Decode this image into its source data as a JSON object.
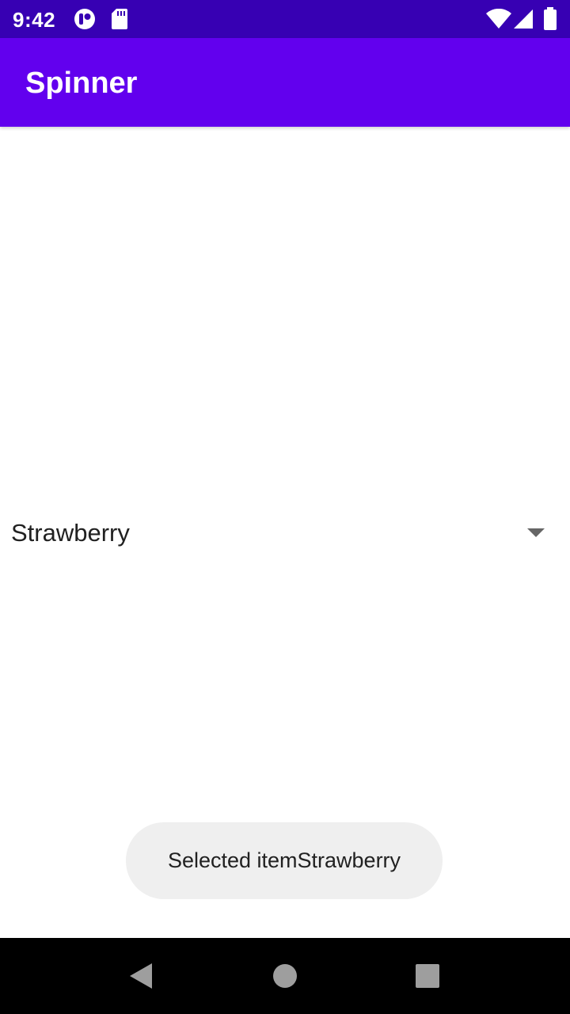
{
  "status_bar": {
    "time": "9:42",
    "icons": [
      "notification-app-icon",
      "sd-card-icon",
      "wifi-icon",
      "cellular-signal-icon",
      "battery-icon"
    ]
  },
  "app_bar": {
    "title": "Spinner",
    "color": "#6200ee",
    "status_color": "#3700b3"
  },
  "spinner": {
    "selected_value": "Strawberry",
    "icon": "dropdown-arrow-icon"
  },
  "toast": {
    "message": "Selected itemStrawberry"
  },
  "nav_bar": {
    "buttons": [
      "back-icon",
      "home-icon",
      "recents-icon"
    ]
  }
}
